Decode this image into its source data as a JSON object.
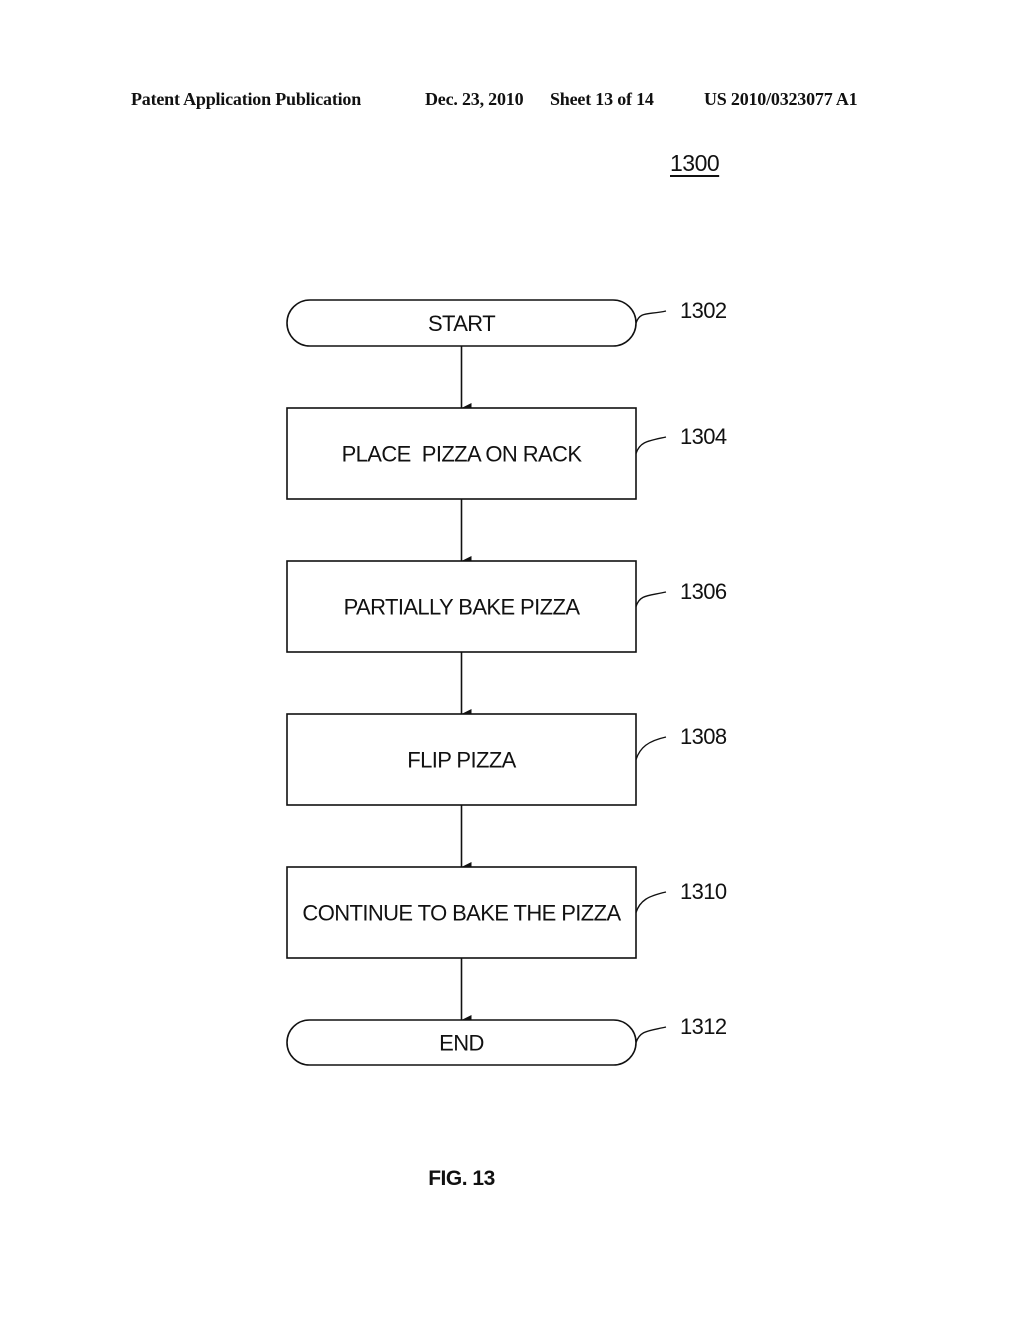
{
  "header": {
    "publication": "Patent Application Publication",
    "date": "Dec. 23, 2010",
    "sheet": "Sheet 13 of 14",
    "patent_number": "US 2010/0323077 A1"
  },
  "figure": {
    "reference": "1300",
    "caption": "FIG. 13"
  },
  "flowchart": {
    "nodes": [
      {
        "id": "1302",
        "type": "terminal",
        "label": "START",
        "ref": "1302"
      },
      {
        "id": "1304",
        "type": "process",
        "label": "PLACE  PIZZA ON RACK",
        "ref": "1304"
      },
      {
        "id": "1306",
        "type": "process",
        "label": "PARTIALLY BAKE PIZZA",
        "ref": "1306"
      },
      {
        "id": "1308",
        "type": "process",
        "label": "FLIP PIZZA",
        "ref": "1308"
      },
      {
        "id": "1310",
        "type": "process",
        "label": "CONTINUE TO BAKE THE PIZZA",
        "ref": "1310"
      },
      {
        "id": "1312",
        "type": "terminal",
        "label": "END",
        "ref": "1312"
      }
    ],
    "edges": [
      {
        "from": "1302",
        "to": "1304"
      },
      {
        "from": "1304",
        "to": "1306"
      },
      {
        "from": "1306",
        "to": "1308"
      },
      {
        "from": "1308",
        "to": "1310"
      },
      {
        "from": "1310",
        "to": "1312"
      }
    ]
  }
}
